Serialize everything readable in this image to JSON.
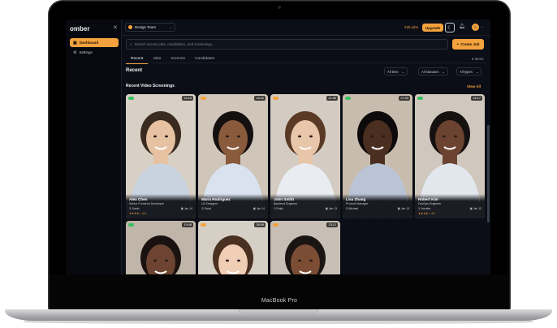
{
  "device": {
    "brand": "MacBook Pro"
  },
  "app": {
    "logo": "omber",
    "close_icon": "close-icon"
  },
  "sidebar": {
    "items": [
      {
        "label": "Dashboard",
        "icon": "grid-icon",
        "active": true
      },
      {
        "label": "Settings",
        "icon": "gear-icon",
        "active": false
      }
    ]
  },
  "topbar": {
    "team": "Design Team",
    "jobs": "225 jobs",
    "upgrade": "Upgrade",
    "avatar_initial": "S"
  },
  "search": {
    "placeholder": "Search across jobs, candidates, and screenings...",
    "icon": "search-icon"
  },
  "create_job": "Create Job",
  "tabs": [
    {
      "label": "Recent",
      "active": true
    },
    {
      "label": "Jobs",
      "active": false
    },
    {
      "label": "Screens",
      "active": false
    },
    {
      "label": "Candidates",
      "active": false
    }
  ],
  "items_count": "6 items",
  "recent": {
    "title": "Recent"
  },
  "filters": [
    "All time",
    "All statuses",
    "All types"
  ],
  "section": {
    "title": "Recent Video Screenings",
    "view_all": "View All"
  },
  "cards": [
    {
      "name": "Alex Chen",
      "role": "Senior Frontend Developer",
      "meta": "Sarah",
      "date": "Jan 14",
      "stars": "★★★★☆ 4.5",
      "duration": "24:15",
      "badge": "green"
    },
    {
      "name": "Maria Rodriguez",
      "role": "UX Designer",
      "meta": "David",
      "date": "Jan 14",
      "stars": "",
      "duration": "18:42",
      "badge": "amber"
    },
    {
      "name": "John Smith",
      "role": "Backend Engineer",
      "meta": "Emily",
      "date": "Jan 13",
      "stars": "",
      "duration": "21:05",
      "badge": "amber"
    },
    {
      "name": "Lisa Zhang",
      "role": "Product Manager",
      "meta": "Michael",
      "date": "Jan 13",
      "stars": "",
      "duration": "27:33",
      "badge": "green"
    },
    {
      "name": "Robert Kim",
      "role": "DevOps Engineer",
      "meta": "Jennifer",
      "date": "Jan 12",
      "stars": "★★★★☆ 4.2",
      "duration": "22:17",
      "badge": "green"
    },
    {
      "name": "",
      "role": "",
      "meta": "",
      "date": "",
      "stars": "",
      "duration": "19:48",
      "badge": "green"
    },
    {
      "name": "",
      "role": "",
      "meta": "",
      "date": "",
      "stars": "",
      "duration": "26:09",
      "badge": "amber"
    },
    {
      "name": "",
      "role": "",
      "meta": "",
      "date": "",
      "stars": "",
      "duration": "23:12",
      "badge": "amber"
    }
  ],
  "colors": {
    "accent": "#f4a23d",
    "background": "#0b0e16",
    "success": "#3bbf63"
  }
}
